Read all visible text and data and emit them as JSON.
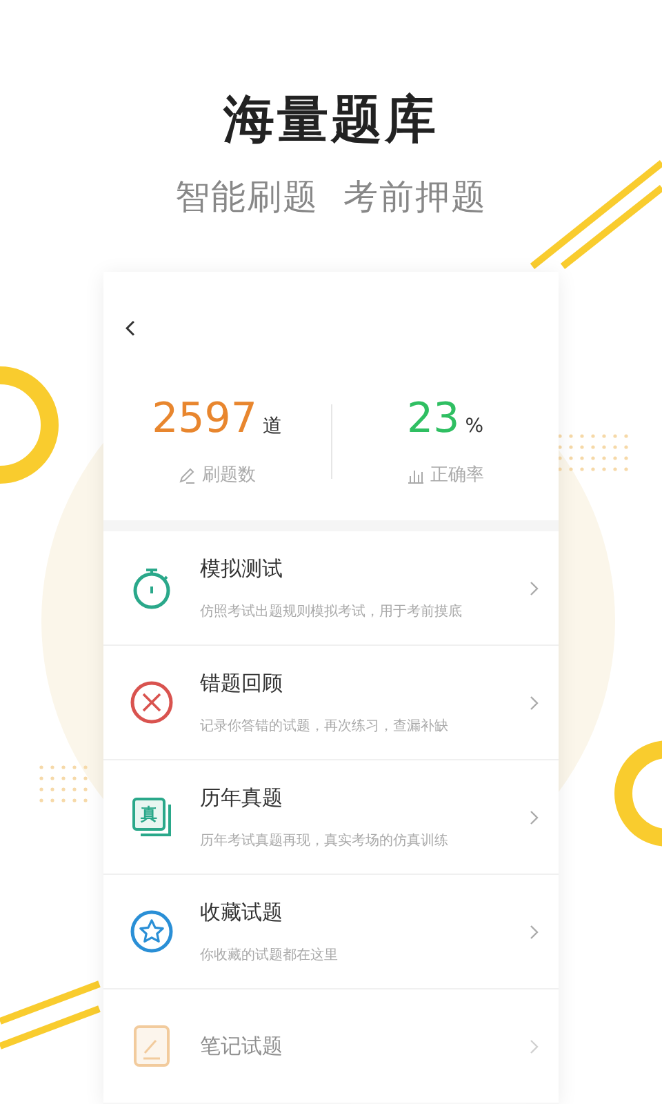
{
  "headline": "海量题库",
  "subheadline": "智能刷题  考前押题",
  "stats": [
    {
      "value": "2597",
      "unit": "道",
      "label": "刷题数",
      "kind": "count"
    },
    {
      "value": "23",
      "unit": "%",
      "label": "正确率",
      "kind": "rate"
    }
  ],
  "menu": [
    {
      "kind": "timer",
      "title": "模拟测试",
      "description": "仿照考试出题规则模拟考试，用于考前摸底"
    },
    {
      "kind": "wrong",
      "title": "错题回顾",
      "description": "记录你答错的试题，再次练习，查漏补缺"
    },
    {
      "kind": "badge",
      "badge": "真",
      "title": "历年真题",
      "description": "历年考试真题再现，真实考场的仿真训练"
    },
    {
      "kind": "star",
      "title": "收藏试题",
      "description": "你收藏的试题都在这里"
    },
    {
      "kind": "note",
      "title": "笔记试题"
    }
  ]
}
